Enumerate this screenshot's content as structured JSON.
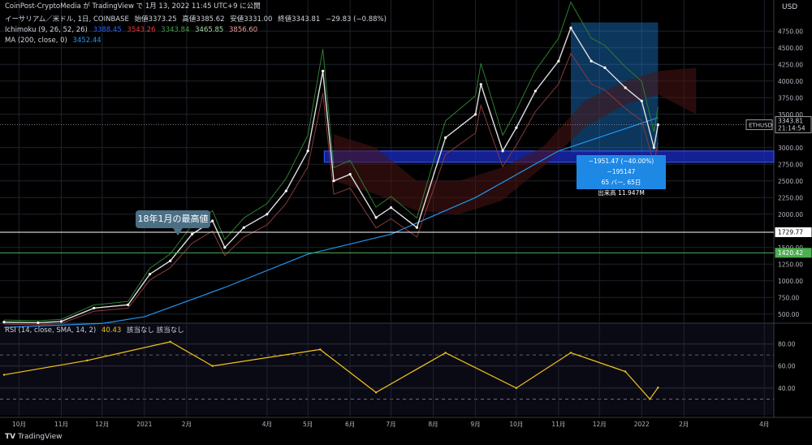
{
  "publish_line": "CoinPost-CryptoMedia が TradingView で 1月 13, 2022 11:45 UTC+9 に公開",
  "symbol_line": {
    "name": "イーサリアム／米ドル, 1日, COINBASE",
    "open": "始値3373.25",
    "high": "高値3385.62",
    "low": "安値3331.00",
    "close": "終値3343.81",
    "change": "−29.83 (−0.88%)"
  },
  "ichimoku": {
    "label": "Ichimoku (9, 26, 52, 26)",
    "v1": "3388.45",
    "v2": "3543.26",
    "v3": "3343.84",
    "v4": "3465.85",
    "v5": "3856.60",
    "colors": [
      "#2962ff",
      "#e53935",
      "#43a047",
      "#a5d6a7",
      "#ef9a9a"
    ]
  },
  "ma": {
    "label": "MA (200, close, 0)",
    "value": "3452.44",
    "color": "#2196f3"
  },
  "rsi": {
    "label": "RSI (14, close, SMA, 14, 2)",
    "value": "40.43",
    "extra": "該当なし 該当なし",
    "color": "#f5c518"
  },
  "currency": "USD",
  "price_axis": [
    "4750.00",
    "4500.00",
    "4250.00",
    "4000.00",
    "3750.00",
    "3500.00",
    "3000.00",
    "2750.00",
    "2500.00",
    "2250.00",
    "2000.00",
    "1500.00",
    "1250.00",
    "1000.00",
    "750.00",
    "500.00"
  ],
  "rsi_axis": [
    "80.00",
    "60.00",
    "40.00"
  ],
  "last_price": {
    "symbol": "ETHUSD",
    "price": "3343.81",
    "countdown": "21:14:54"
  },
  "lines": {
    "high_2018": "1729.77",
    "green_line": "1420.42"
  },
  "annotation": "18年1月の最高値",
  "measure": {
    "line1": "−1951.47 (−40.00%) −195147",
    "line2": "65 バー, 65日",
    "line3": "出来高 11.947M"
  },
  "time_axis": [
    "10月",
    "11月",
    "12月",
    "2021",
    "2月",
    "4月",
    "5月",
    "6月",
    "7月",
    "8月",
    "9月",
    "10月",
    "11月",
    "12月",
    "2022",
    "2月",
    "4月"
  ],
  "footer": "TradingView",
  "chart_data": {
    "type": "line",
    "title": "イーサリアム／米ドル, 1日, COINBASE",
    "series": [
      {
        "name": "ETHUSD",
        "dates": [
          "2020-09-20",
          "2020-10-15",
          "2020-11-01",
          "2020-11-25",
          "2020-12-20",
          "2021-01-05",
          "2021-01-20",
          "2021-02-05",
          "2021-02-20",
          "2021-03-01",
          "2021-03-15",
          "2021-04-01",
          "2021-04-15",
          "2021-05-01",
          "2021-05-12",
          "2021-05-20",
          "2021-06-01",
          "2021-06-20",
          "2021-07-01",
          "2021-07-20",
          "2021-08-10",
          "2021-09-01",
          "2021-09-05",
          "2021-09-21",
          "2021-10-01",
          "2021-10-15",
          "2021-11-01",
          "2021-11-10",
          "2021-11-25",
          "2021-12-05",
          "2021-12-20",
          "2022-01-01",
          "2022-01-10",
          "2022-01-13"
        ],
        "values": [
          380,
          370,
          390,
          590,
          640,
          1100,
          1300,
          1700,
          1900,
          1500,
          1800,
          2000,
          2350,
          2950,
          4150,
          2500,
          2600,
          1950,
          2100,
          1800,
          3150,
          3500,
          3950,
          2950,
          3300,
          3850,
          4300,
          4800,
          4300,
          4200,
          3900,
          3700,
          3000,
          3344
        ]
      },
      {
        "name": "MA (200, close, 0)",
        "dates": [
          "2020-09-20",
          "2020-12-01",
          "2021-01-01",
          "2021-03-01",
          "2021-05-01",
          "2021-07-01",
          "2021-09-01",
          "2021-11-01",
          "2022-01-13"
        ],
        "values": [
          300,
          360,
          460,
          900,
          1400,
          1700,
          2250,
          2950,
          3450
        ]
      }
    ],
    "rsi": {
      "name": "RSI (14, close, SMA, 14, 2)",
      "dates": [
        "2020-09-20",
        "2020-11-20",
        "2021-01-20",
        "2021-02-20",
        "2021-05-10",
        "2021-06-20",
        "2021-08-10",
        "2021-10-01",
        "2021-11-10",
        "2021-12-20",
        "2022-01-07",
        "2022-01-13"
      ],
      "values": [
        52,
        65,
        82,
        60,
        75,
        36,
        72,
        40,
        72,
        55,
        30,
        40.43
      ]
    },
    "ylim": [
      400,
      4900
    ],
    "rsi_ylim": [
      20,
      90
    ]
  }
}
